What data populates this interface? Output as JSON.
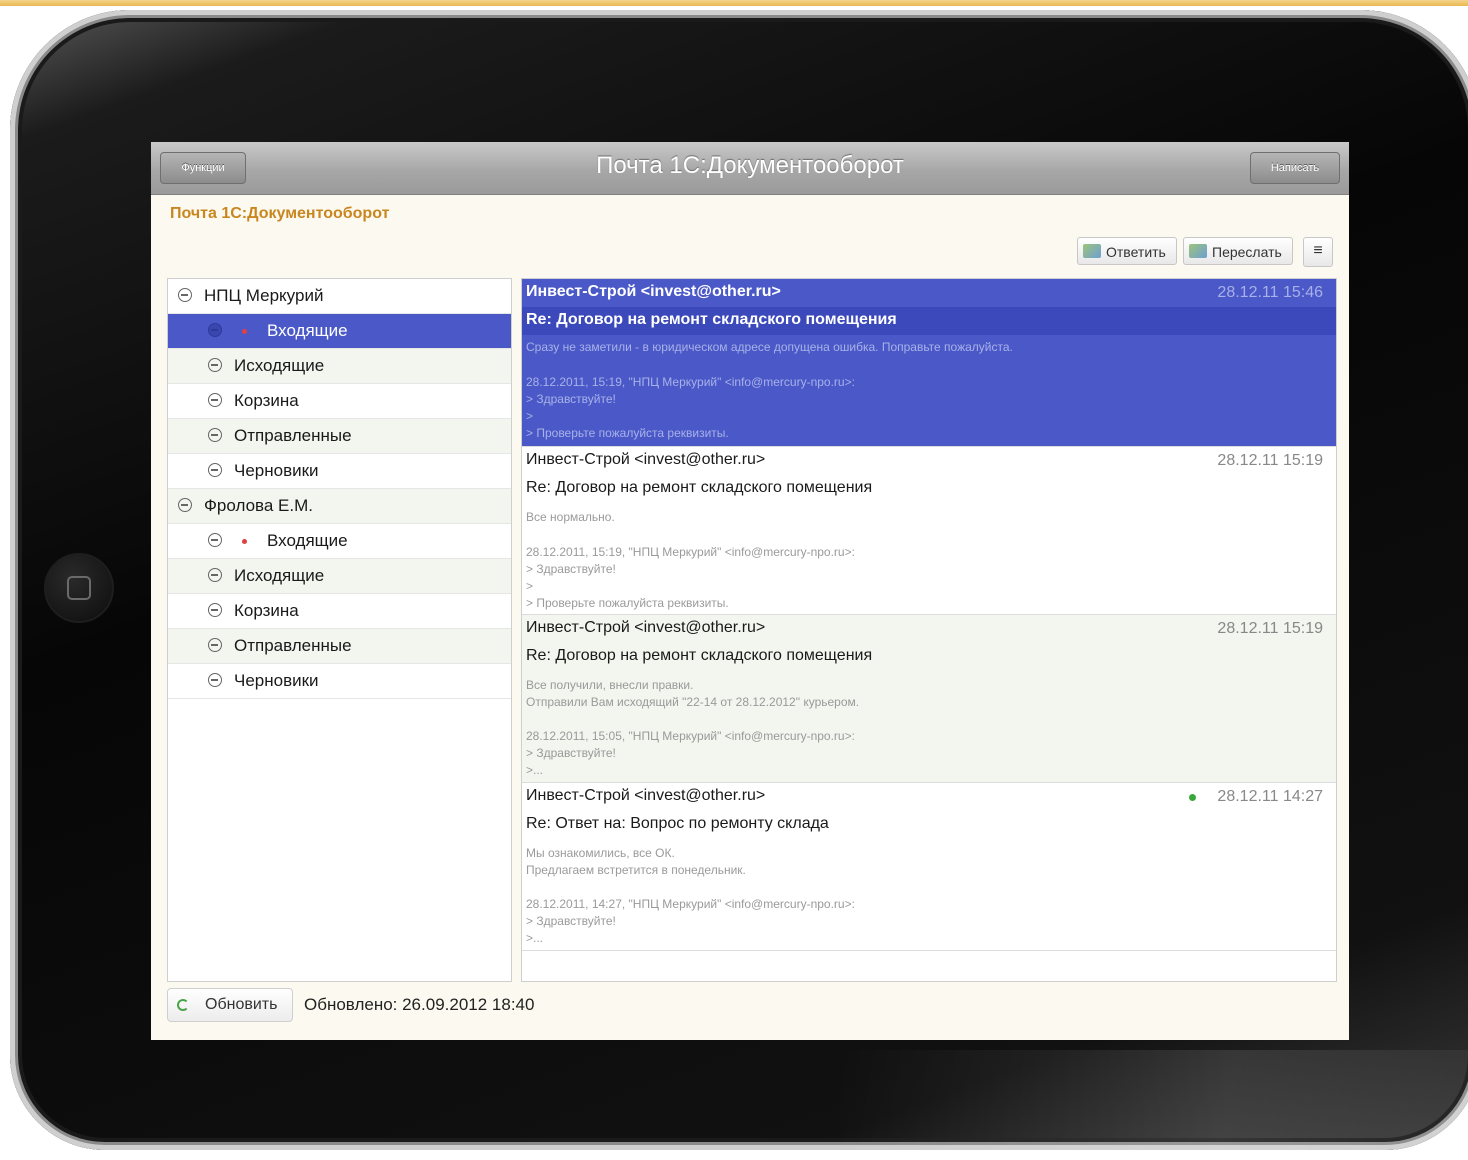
{
  "titlebar": {
    "functions_label": "Функции",
    "title": "Почта 1С:Документооборот",
    "compose_label": "Написать"
  },
  "app_heading": "Почта 1С:Документооборот",
  "actions": {
    "reply_label": "Ответить",
    "forward_label": "Переслать",
    "menu_icon": "≡"
  },
  "folders": {
    "accounts": [
      {
        "name": "НПЦ Меркурий",
        "items": [
          "Входящие",
          "Исходящие",
          "Корзина",
          "Отправленные",
          "Черновики"
        ]
      },
      {
        "name": "Фролова Е.М.",
        "items": [
          "Входящие",
          "Исходящие",
          "Корзина",
          "Отправленные",
          "Черновики"
        ]
      }
    ]
  },
  "messages": [
    {
      "from": "Инвест-Строй <invest@other.ru>",
      "date": "28.12.11 15:46",
      "subject": "Re: Договор на ремонт складского помещения",
      "preview": [
        "Сразу не заметили - в юридическом адресе допущена ошибка. Поправьте пожалуйста.",
        "",
        "28.12.2011, 15:19, \"НПЦ Меркурий\" <info@mercury-npo.ru>:",
        "> Здравствуйте!",
        ">",
        "> Проверьте пожалуйста реквизиты."
      ]
    },
    {
      "from": "Инвест-Строй <invest@other.ru>",
      "date": "28.12.11 15:19",
      "subject": "Re: Договор на ремонт складского помещения",
      "preview": [
        "Все нормально.",
        "",
        "28.12.2011, 15:19, \"НПЦ Меркурий\" <info@mercury-npo.ru>:",
        "> Здравствуйте!",
        ">",
        "> Проверьте пожалуйста реквизиты."
      ]
    },
    {
      "from": "Инвест-Строй <invest@other.ru>",
      "date": "28.12.11 15:19",
      "subject": "Re: Договор на ремонт складского помещения",
      "preview": [
        "Все получили, внесли правки.",
        "Отправили Вам исходящий \"22-14 от 28.12.2012\" курьером.",
        "",
        "28.12.2011, 15:05, \"НПЦ Меркурий\" <info@mercury-npo.ru>:",
        "> Здравствуйте!",
        ">..."
      ]
    },
    {
      "from": "Инвест-Строй <invest@other.ru>",
      "date": "28.12.11 14:27",
      "subject": "Re: Ответ на: Вопрос по ремонту склада",
      "preview": [
        "Мы ознакомились, все ОК.",
        "Предлагаем встретится в понедельник.",
        "",
        "28.12.2011, 14:27, \"НПЦ Меркурий\" <info@mercury-npo.ru>:",
        "> Здравствуйте!",
        ">..."
      ]
    }
  ],
  "footer": {
    "refresh_label": "Обновить",
    "updated_text": "Обновлено: 26.09.2012 18:40"
  },
  "colors": {
    "selection": "#4b59c8",
    "heading": "#c9861f",
    "background": "#fcfaf0"
  }
}
